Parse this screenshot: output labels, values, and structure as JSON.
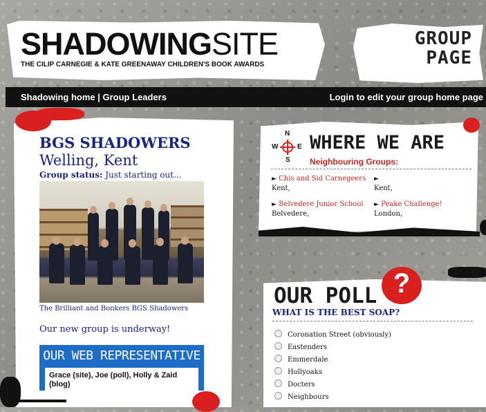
{
  "header": {
    "logo_bold": "SHADOWING",
    "logo_light": "SITE",
    "logo_subtitle": "THE CILIP CARNEGIE & KATE GREENAWAY CHILDREN'S BOOK AWARDS",
    "group_page_line1": "GROUP",
    "group_page_line2": "PAGE"
  },
  "nav": {
    "home": "Shadowing home",
    "separator": " | ",
    "leaders": "Group Leaders",
    "login": "Login to edit your group home page"
  },
  "group": {
    "name": "BGS SHADOWERS",
    "location": "Welling, Kent",
    "status_label": "Group status:",
    "status_value": " Just starting out...",
    "photo_caption": "The Brilliant and Bonkers BGS Shadowers",
    "message": "Our new group is underway!",
    "rep_title": "OUR WEB REPRESENTATIVE",
    "rep_text": "Grace (site), Joe (poll), Holly & Zaid (blog)"
  },
  "where": {
    "title": "WHERE WE ARE",
    "neighbouring_label": "Neighbouring Groups:",
    "compass": {
      "n": "N",
      "s": "S",
      "w": "W",
      "e": "E"
    },
    "groups": [
      {
        "name": "Chis and Sid Carnegeers",
        "location": "Kent,"
      },
      {
        "name": "",
        "location": "Kent,"
      },
      {
        "name": "Belvedere Junior School",
        "location": "Belvedere,"
      },
      {
        "name": "Peake Challenge!",
        "location": "London,"
      }
    ]
  },
  "poll": {
    "title": "OUR POLL",
    "question": "WHAT IS THE BEST SOAP?",
    "options": [
      "Coronation Street (obviously)",
      "Eastenders",
      "Emmerdale",
      "Hollyoaks",
      "Docters",
      "Neighbours"
    ]
  },
  "colors": {
    "accent_red": "#d9201f",
    "nav_bg": "#111111",
    "title_blue": "#1a237e",
    "rep_blue": "#1d6cc8"
  }
}
